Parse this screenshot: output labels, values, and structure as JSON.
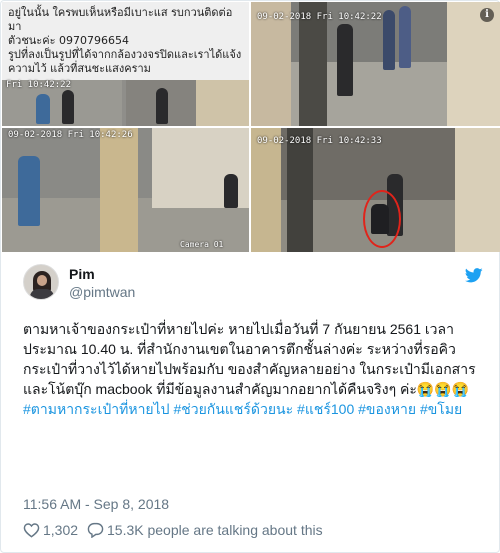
{
  "media": {
    "note_lines": [
      "อยู่ในนั้น ใครพบเห็นหรือมีเบาะแส รบกวนติดต่อมา",
      "ตัวชนะค่ะ 0970796654",
      "รูปที่ลงเป็นรูปที่ได้จากกล้องวงจรปิดและเราได้แจ้ง",
      "ความไว้ แล้วที่สนชะแสงคราม"
    ],
    "stamp_small": "Fri 10:42:22",
    "stamp_1": "09-02-2018 Fri 10:42:22",
    "stamp_2": "09-02-2018 Fri 10:42:26",
    "stamp_3": "09-02-2018 Fri 10:42:33",
    "camera_label": "Camera 01",
    "info_symbol": "i"
  },
  "author": {
    "display_name": "Pim",
    "handle": "@pimtwan",
    "avatar_icon": "avatar",
    "brand_color": "#1da1f2"
  },
  "tweet": {
    "text_segments": [
      {
        "text": "ตามหาเจ้าของกระเป๋าที่หายไปค่ะ",
        "tag": false
      },
      {
        "text": " หายไปเมื่อวันที่ 7 กันยายน 2561 เวลาประมาณ 10.40 น. ที่สำนักงานเขตในอาคารตึกชั้นล่างค่ะ ",
        "tag": false
      },
      {
        "text": "ระหว่างที่รอคิว กระเป๋าที่วางไว้ได้หายไปพร้อมกับ",
        "tag": false
      },
      {
        "text": " ของสำคัญหลายอย่าง ในกระเป๋ามีเอกสารและโน้ตบุ๊ก macbook ",
        "tag": false
      },
      {
        "text": "ที่มีข้อมูลงานสำคัญมากอยากได้คืนจริงๆ ค่ะ",
        "tag": false
      },
      {
        "text": "😭😭😭 ",
        "tag": false
      },
      {
        "text": "#ตามหากระเป๋าที่หายไป",
        "tag": true
      },
      {
        "text": " ",
        "tag": false
      },
      {
        "text": "#ช่วยกันแชร์ด้วยนะ",
        "tag": true
      },
      {
        "text": " ",
        "tag": false
      },
      {
        "text": "#แชร์100",
        "tag": true
      },
      {
        "text": " ",
        "tag": false
      },
      {
        "text": "#ของหาย",
        "tag": true
      },
      {
        "text": " ",
        "tag": false
      },
      {
        "text": "#ขโมย",
        "tag": true
      }
    ],
    "hashtag_color": "#1b95e0"
  },
  "meta": {
    "timestamp": "11:56 AM - Sep 8, 2018",
    "likes": "1,302",
    "talking": "15.3K people are talking about this"
  },
  "icons": {
    "heart": "heart-icon",
    "talk": "speech-bubble-icon",
    "twitter": "twitter-bird-icon",
    "info": "info-icon"
  }
}
